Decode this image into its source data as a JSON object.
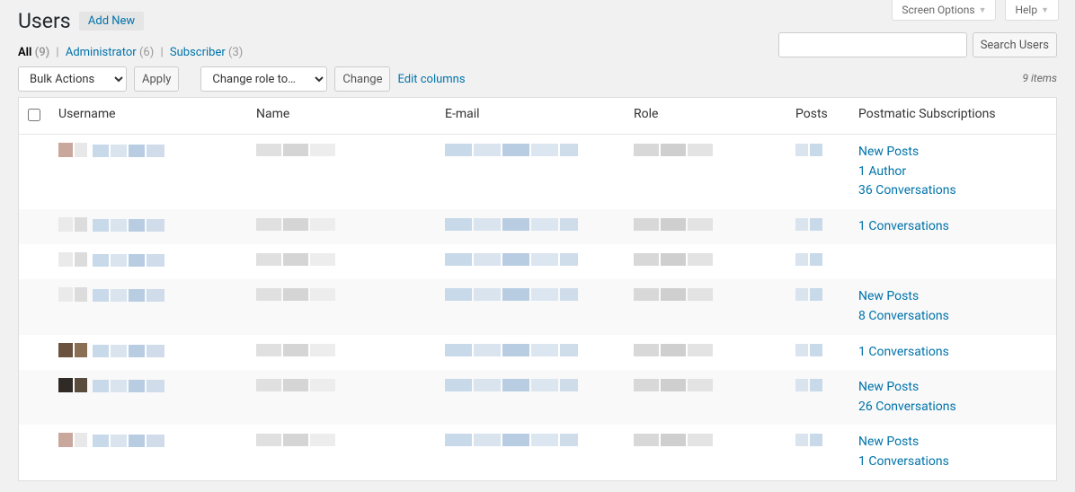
{
  "screen_tabs": {
    "options": "Screen Options",
    "help": "Help"
  },
  "page": {
    "title": "Users",
    "add_new": "Add New"
  },
  "filters": {
    "all_label": "All",
    "all_count": "(9)",
    "admin_label": "Administrator",
    "admin_count": "(6)",
    "sub_label": "Subscriber",
    "sub_count": "(3)"
  },
  "bulk": {
    "bulk_actions": "Bulk Actions",
    "apply": "Apply",
    "change_role": "Change role to…",
    "change": "Change",
    "edit_columns": "Edit columns"
  },
  "search": {
    "button": "Search Users"
  },
  "items_count": "9 items",
  "columns": {
    "username": "Username",
    "name": "Name",
    "email": "E-mail",
    "role": "Role",
    "posts": "Posts",
    "subs": "Postmatic Subscriptions"
  },
  "rows": [
    {
      "subs": [
        "New Posts",
        "1 Author",
        "36 Conversations"
      ]
    },
    {
      "subs": [
        "1 Conversations"
      ]
    },
    {
      "subs": []
    },
    {
      "subs": [
        "New Posts",
        "8 Conversations"
      ]
    },
    {
      "subs": [
        "1 Conversations"
      ]
    },
    {
      "subs": [
        "New Posts",
        "26 Conversations"
      ]
    },
    {
      "subs": [
        "New Posts",
        "1 Conversations"
      ]
    }
  ]
}
